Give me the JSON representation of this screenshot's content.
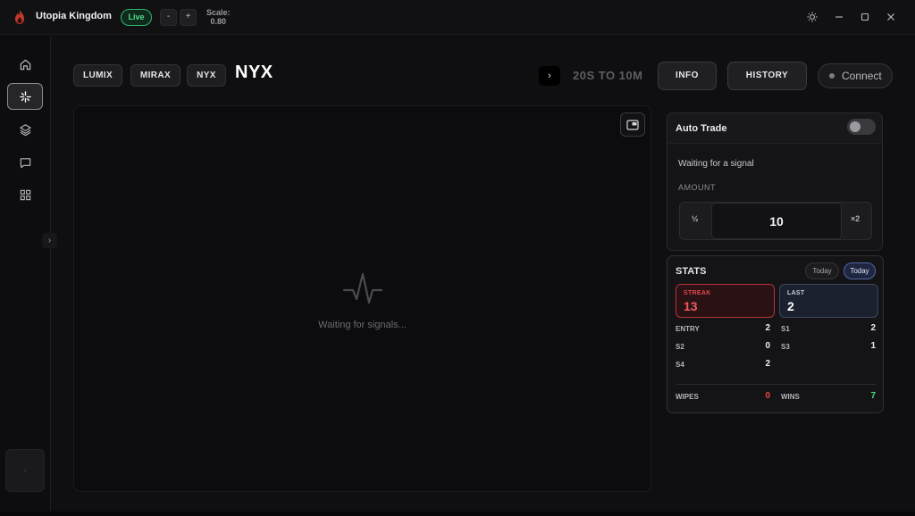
{
  "app": {
    "title": "Utopia Kingdom",
    "status": "Live",
    "scale_label": "Scale:",
    "scale_value": "0.80",
    "scale_minus": "-",
    "scale_plus": "+"
  },
  "window_controls": [
    "sun-icon",
    "minimize-icon",
    "maximize-icon",
    "close-icon"
  ],
  "sidebar": {
    "items": [
      {
        "icon": "home-icon",
        "active": false
      },
      {
        "icon": "sparkle-icon",
        "active": true
      },
      {
        "icon": "layers-icon",
        "active": false
      },
      {
        "icon": "chat-icon",
        "active": false
      },
      {
        "icon": "grid-icon",
        "active": false
      }
    ],
    "expand_glyph": "›"
  },
  "header": {
    "assets": [
      "LUMIX",
      "MIRAX",
      "NYX"
    ],
    "current_asset": "NYX",
    "next_glyph": "›",
    "timeframe": "20S TO 10M",
    "info_label": "INFO",
    "history_label": "HISTORY",
    "connect_label": "Connect"
  },
  "chart": {
    "waiting_text": "Waiting for signals..."
  },
  "auto_trade": {
    "title": "Auto Trade",
    "enabled": false,
    "status": "Waiting for a signal",
    "amount_label": "AMOUNT",
    "half_label": "½",
    "amount": "10",
    "double_label": "×2"
  },
  "stats": {
    "title": "STATS",
    "filters": [
      "Today",
      "Today"
    ],
    "active_filter_index": 1,
    "streak": {
      "label": "STREAK",
      "value": "13"
    },
    "last": {
      "label": "LAST",
      "value": "2"
    },
    "rows": [
      {
        "label": "ENTRY",
        "value": "2"
      },
      {
        "label": "S1",
        "value": "2"
      },
      {
        "label": "S2",
        "value": "0"
      },
      {
        "label": "S3",
        "value": "1"
      },
      {
        "label": "S4",
        "value": "2"
      }
    ],
    "wipes": {
      "label": "WIPES",
      "value": "0"
    },
    "wins": {
      "label": "WINS",
      "value": "7"
    }
  },
  "colors": {
    "accent_green": "#4ee08d",
    "streak_red": "#e5484d",
    "wins_green": "#4ade80",
    "wipes_red": "#ef4444"
  }
}
